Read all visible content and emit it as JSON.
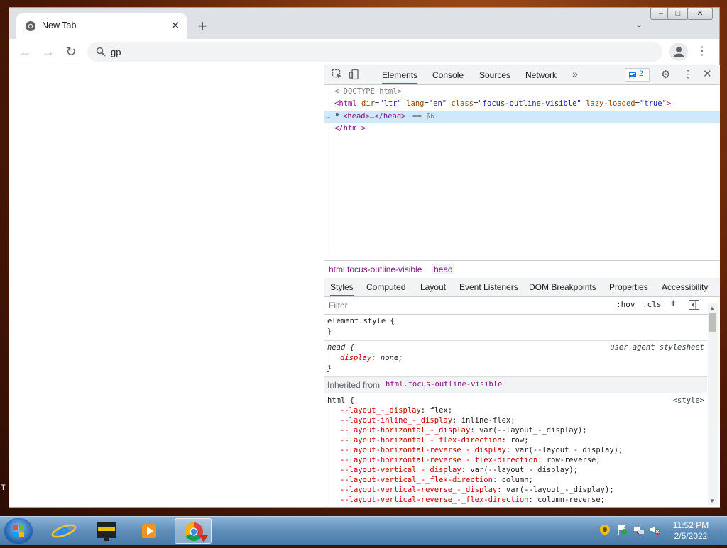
{
  "browser": {
    "tab_title": "New Tab",
    "omnibox_text": "gp",
    "caption": {
      "minimize": "–",
      "maximize": "□",
      "close": "✕"
    }
  },
  "devtools": {
    "tabs": [
      "Elements",
      "Console",
      "Sources",
      "Network"
    ],
    "active_tab": "Elements",
    "more_tabs": "»",
    "issues_count": "2",
    "dom": {
      "doctype": "<!DOCTYPE html>",
      "html_open": {
        "tag_start": "<html",
        "attrs": [
          {
            "name": "dir",
            "value": "\"ltr\""
          },
          {
            "name": "lang",
            "value": "\"en\""
          },
          {
            "name": "class",
            "value": "\"focus-outline-visible\""
          },
          {
            "name": "lazy-loaded",
            "value": "\"true\""
          }
        ],
        "tag_end": ">"
      },
      "selected_line": {
        "dots": "…",
        "text": "<head>…</head>",
        "suffix": "== $0"
      },
      "html_close": "</html>"
    },
    "breadcrumb": [
      "html.focus-outline-visible",
      "head"
    ],
    "subtabs": [
      "Styles",
      "Computed",
      "Layout",
      "Event Listeners",
      "DOM Breakpoints",
      "Properties",
      "Accessibility"
    ],
    "active_subtab": "Styles",
    "filter_placeholder": "Filter",
    "filter_tools": {
      "hov": ":hov",
      "cls": ".cls",
      "plus": "+"
    },
    "styles": {
      "element_style": {
        "selector": "element.style {",
        "close": "}"
      },
      "head_rule": {
        "selector": "head {",
        "source": "user agent stylesheet",
        "declarations": [
          {
            "prop": "display",
            "value": "none;"
          }
        ],
        "close": "}"
      },
      "inherited_label": "Inherited from",
      "inherited_from": "html.focus-outline-visible",
      "html_rule": {
        "selector": "html {",
        "source": "<style>",
        "declarations": [
          {
            "prop": "--layout_-_display",
            "value": "flex;"
          },
          {
            "prop": "--layout-inline_-_display",
            "value": "inline-flex;"
          },
          {
            "prop": "--layout-horizontal_-_display",
            "value": "var(--layout_-_display);"
          },
          {
            "prop": "--layout-horizontal_-_flex-direction",
            "value": "row;"
          },
          {
            "prop": "--layout-horizontal-reverse_-_display",
            "value": "var(--layout_-_display);"
          },
          {
            "prop": "--layout-horizontal-reverse_-_flex-direction",
            "value": "row-reverse;"
          },
          {
            "prop": "--layout-vertical_-_display",
            "value": "var(--layout_-_display);"
          },
          {
            "prop": "--layout-vertical_-_flex-direction",
            "value": "column;"
          },
          {
            "prop": "--layout-vertical-reverse_-_display",
            "value": "var(--layout_-_display);"
          },
          {
            "prop": "--layout-vertical-reverse_-_flex-direction",
            "value": "column-reverse;"
          }
        ]
      }
    }
  },
  "taskbar": {
    "clock_time": "11:52 PM",
    "clock_date": "2/5/2022",
    "pinned": [
      "internet-explorer",
      "media-center",
      "windows-media-player",
      "chrome"
    ],
    "active": "chrome"
  },
  "desktop": {
    "edge_letter": "T"
  },
  "colors": {
    "accent": "#1a73e8",
    "selection": "#cfe8fc",
    "tag": "#881280",
    "attribute": "#994500",
    "value": "#1a1aa6",
    "property": "#c80000"
  }
}
